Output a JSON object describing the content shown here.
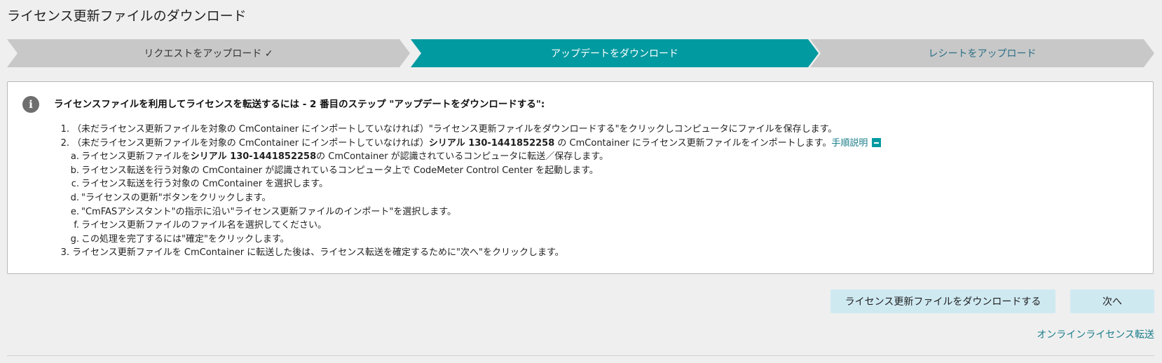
{
  "page_title": "ライセンス更新ファイルのダウンロード",
  "steps": [
    {
      "label": "リクエストをアップロード ✓",
      "state": "done"
    },
    {
      "label": "アップデートをダウンロード",
      "state": "active"
    },
    {
      "label": "レシートをアップロード",
      "state": "pending"
    }
  ],
  "info": {
    "icon": "info-icon",
    "heading": "ライセンスファイルを利用してライセンスを転送するには - 2 番目のステップ \"アップデートをダウンロードする\":",
    "item1": {
      "num": "1.",
      "text": "（未だライセンス更新ファイルを対象の CmContainer にインポートしていなければ）\"ライセンス更新ファイルをダウンロードする\"をクリックしコンピュータにファイルを保存します。"
    },
    "item2": {
      "num": "2.",
      "pre": "（未だライセンス更新ファイルを対象の CmContainer にインポートしていなければ）",
      "serial": "シリアル 130-1441852258",
      "post": " の CmContainer にライセンス更新ファイルをインポートします。",
      "link": "手順説明",
      "subs": {
        "a": {
          "letter": "a.",
          "pre": "ライセンス更新ファイルを",
          "serial": "シリアル 130-1441852258",
          "post": "の CmContainer が認識されているコンピュータに転送／保存します。"
        },
        "b": {
          "letter": "b.",
          "text": "ライセンス転送を行う対象の CmContainer が認識されているコンピュータ上で CodeMeter Control Center を起動します。"
        },
        "c": {
          "letter": "c.",
          "text": "ライセンス転送を行う対象の CmContainer を選択します。"
        },
        "d": {
          "letter": "d.",
          "text": "\"ライセンスの更新\"ボタンをクリックします。"
        },
        "e": {
          "letter": "e.",
          "text": "\"CmFASアシスタント\"の指示に沿い\"ライセンス更新ファイルのインポート\"を選択します。"
        },
        "f": {
          "letter": "f.",
          "text": "ライセンス更新ファイルのファイル名を選択してください。"
        },
        "g": {
          "letter": "g.",
          "text": "この処理を完了するには\"確定\"をクリックします。"
        }
      }
    },
    "item3": {
      "num": "3.",
      "text": "ライセンス更新ファイルを CmContainer に転送した後は、ライセンス転送を確定するために\"次へ\"をクリックします。"
    }
  },
  "buttons": {
    "download": "ライセンス更新ファイルをダウンロードする",
    "next": "次へ"
  },
  "online_link": "オンラインライセンス転送",
  "colors": {
    "accent": "#009aa0",
    "button_bg": "#cfe9f1",
    "link": "#1a7d8a"
  }
}
